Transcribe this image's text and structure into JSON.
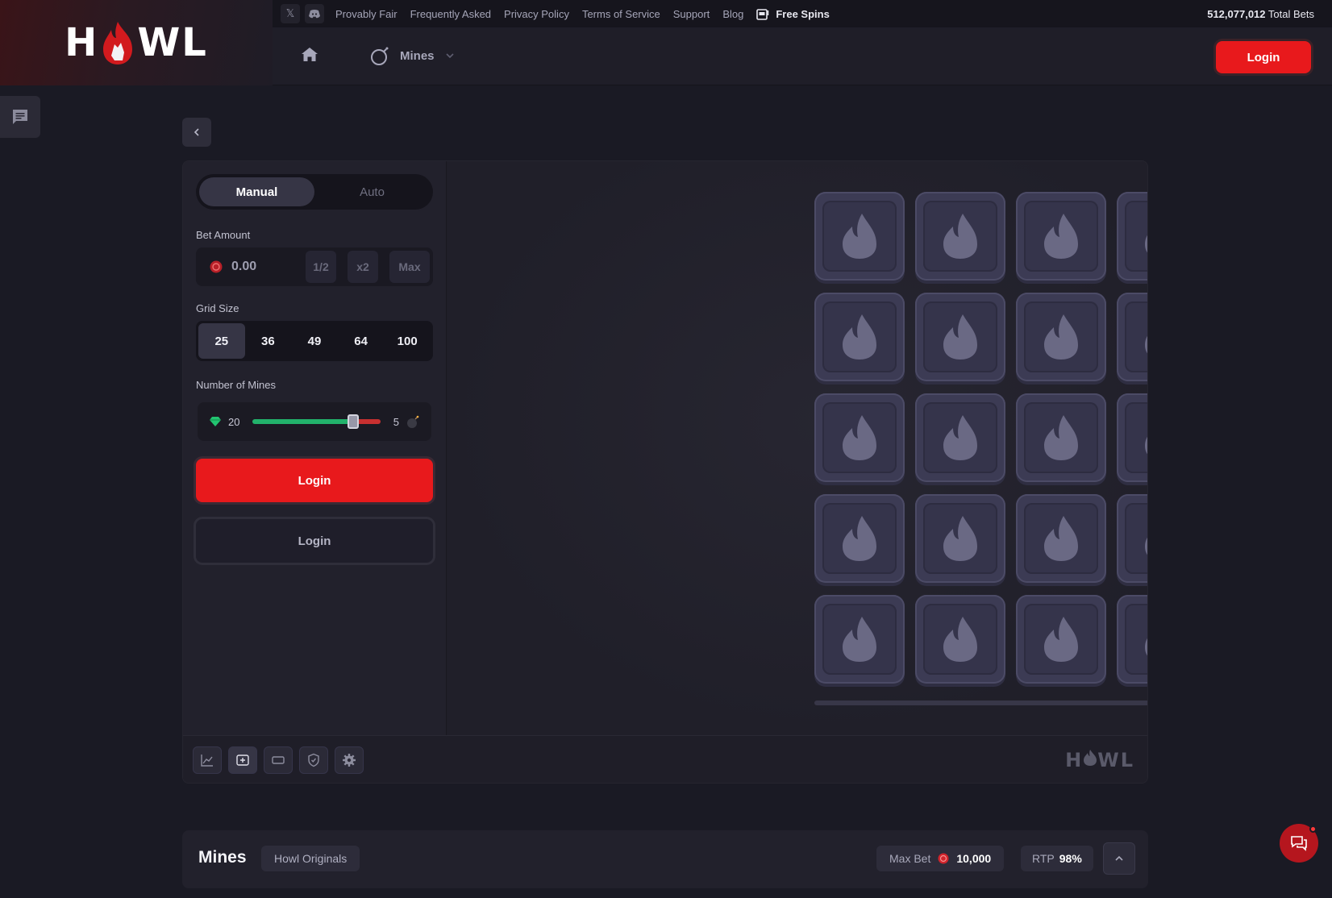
{
  "brand": {
    "logo_text_left": "H",
    "logo_text_right": "WL"
  },
  "topbar": {
    "links": [
      "Provably Fair",
      "Frequently Asked",
      "Privacy Policy",
      "Terms of Service",
      "Support",
      "Blog"
    ],
    "free_spins": "Free Spins",
    "total_bets_value": "512,077,012",
    "total_bets_label": "Total Bets"
  },
  "nav": {
    "game_label": "Mines",
    "login_label": "Login"
  },
  "panel": {
    "modes": [
      "Manual",
      "Auto"
    ],
    "active_mode": "Manual",
    "bet_amount_label": "Bet Amount",
    "bet_amount_value": "0.00",
    "bet_half": "1/2",
    "bet_double": "x2",
    "bet_max": "Max",
    "grid_size_label": "Grid Size",
    "grid_sizes": [
      "25",
      "36",
      "49",
      "64",
      "100"
    ],
    "active_grid_size": "25",
    "mines_label": "Number of Mines",
    "gems_count": "20",
    "mines_count": "5",
    "mines_fraction": 0.2,
    "login_primary": "Login",
    "login_secondary": "Login"
  },
  "board": {
    "rows": 5,
    "cols": 5
  },
  "footer_logo": {
    "left": "H",
    "right": "WL"
  },
  "info": {
    "title": "Mines",
    "tag": "Howl Originals",
    "max_bet_label": "Max Bet",
    "max_bet_value": "10,000",
    "rtp_label": "RTP",
    "rtp_value": "98%"
  },
  "colors": {
    "accent": "#e8191c",
    "gem": "#22b26b",
    "mine": "#c83030",
    "tile": "#3c3b54"
  }
}
